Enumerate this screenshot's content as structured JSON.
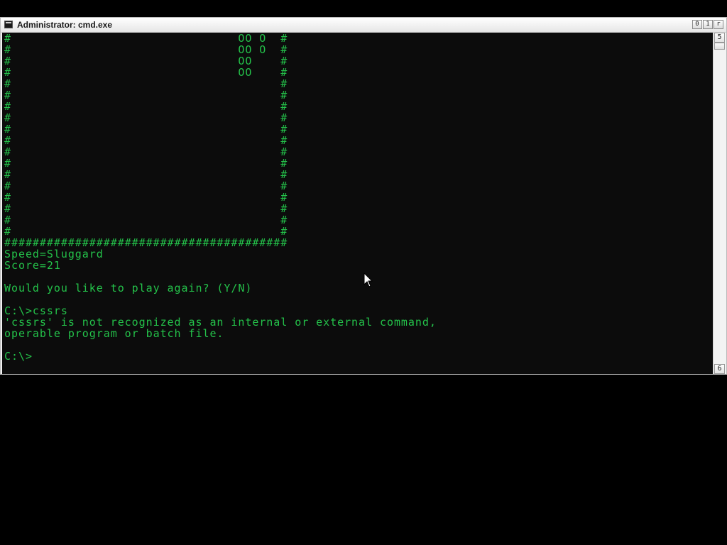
{
  "window": {
    "title": "Administrator: cmd.exe",
    "buttons": {
      "minimize": "0",
      "maximize": "1",
      "close": "r"
    }
  },
  "scrollbar": {
    "up_glyph": "5",
    "down_glyph": "6"
  },
  "console": {
    "lines": [
      "#                                OO O  #",
      "#                                OO O  #",
      "#                                OO    #",
      "#                                OO    #",
      "#                                      #",
      "#                                      #",
      "#                                      #",
      "#                                      #",
      "#                                      #",
      "#                                      #",
      "#                                      #",
      "#                                      #",
      "#                                      #",
      "#                                      #",
      "#                                      #",
      "#                                      #",
      "#                                      #",
      "#                                      #",
      "########################################",
      "Speed=Sluggard",
      "Score=21",
      "",
      "Would you like to play again? (Y/N)",
      "",
      "C:\\>cssrs",
      "'cssrs' is not recognized as an internal or external command,",
      "operable program or batch file.",
      "",
      "C:\\>"
    ]
  },
  "colors": {
    "console_text": "#24c24a",
    "console_background": "#0c0c0c",
    "desktop_background": "#000000"
  },
  "icons": {
    "window_icon": "console-icon",
    "pointer": "mouse-pointer-icon"
  }
}
